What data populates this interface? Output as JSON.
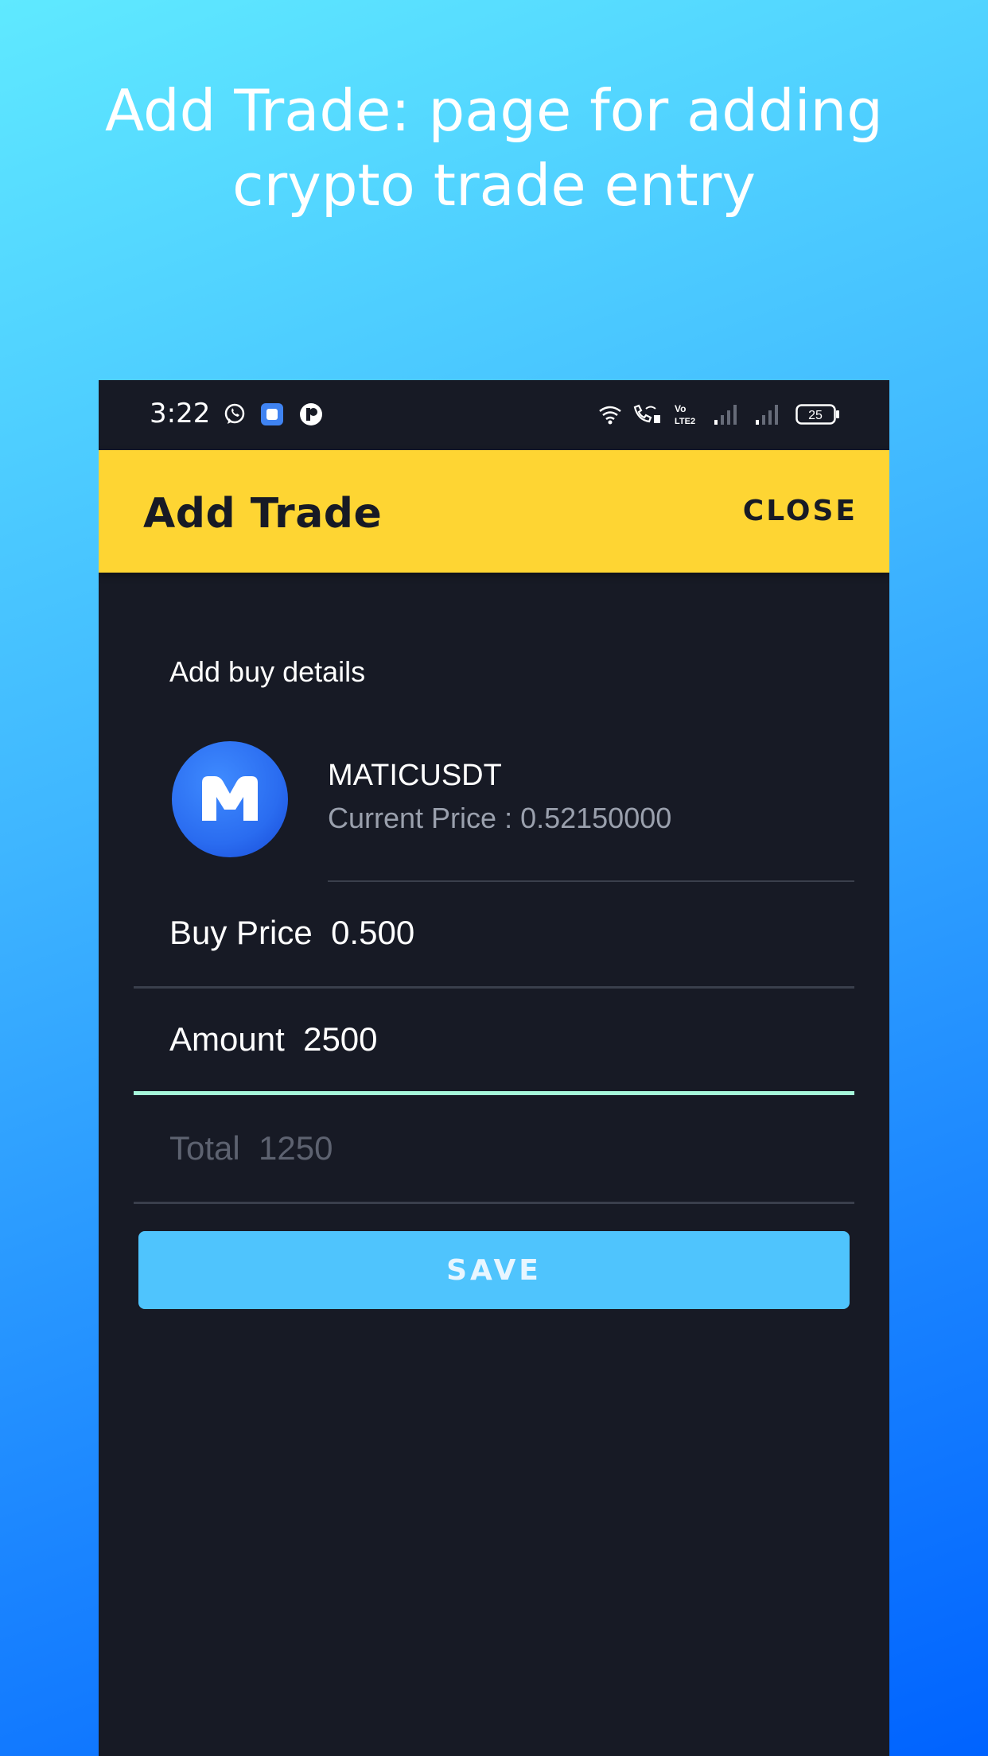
{
  "promo": {
    "title": "Add Trade: page for adding crypto trade entry"
  },
  "status_bar": {
    "time": "3:22",
    "battery": "25",
    "icons": [
      "whatsapp-icon",
      "app-icon",
      "app-icon-2",
      "wifi-icon",
      "wifi-calling-icon",
      "volte-icon",
      "signal-icon",
      "signal-icon-2",
      "battery-icon"
    ]
  },
  "app_bar": {
    "title": "Add Trade",
    "close_label": "CLOSE"
  },
  "form": {
    "section_label": "Add buy details",
    "coin": {
      "symbol": "MATICUSDT",
      "current_price": "Current Price : 0.52150000",
      "logo_icon": "polygon-matic-icon"
    },
    "buy_price": "Buy Price  0.500",
    "amount": "Amount  2500",
    "total": "Total  1250",
    "save_label": "SAVE"
  },
  "colors": {
    "app_bar": "#fed533",
    "background": "#171a25",
    "save_button": "#4fc4fd",
    "active_underline": "#a6f7da"
  }
}
